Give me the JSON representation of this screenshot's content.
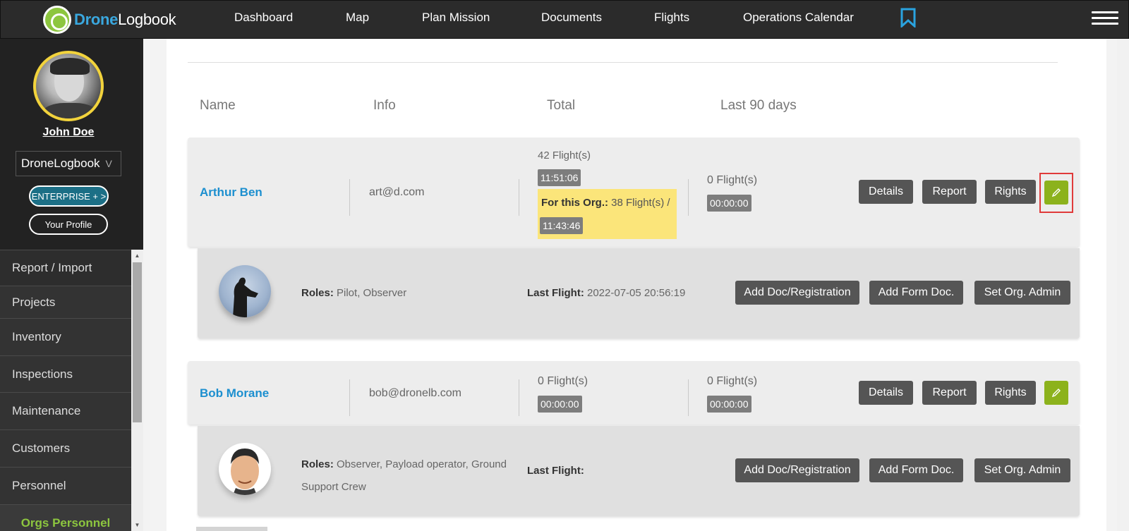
{
  "app": {
    "logo_part1": "Drone",
    "logo_part2": "Logbook"
  },
  "nav": {
    "items": [
      "Dashboard",
      "Map",
      "Plan Mission",
      "Documents",
      "Flights",
      "Operations Calendar"
    ]
  },
  "sidebar": {
    "user_name": "John Doe",
    "org": "DroneLogbook",
    "org_chevron": "V",
    "enterprise_label": "ENTERPRISE + >",
    "profile_label": "Your Profile",
    "menu": [
      "Report / Import",
      "Projects",
      "Inventory",
      "Inspections",
      "Maintenance",
      "Customers",
      "Personnel",
      "Orgs Personnel"
    ]
  },
  "table": {
    "headers": [
      "Name",
      "Info",
      "Total",
      "Last 90 days"
    ]
  },
  "people": [
    {
      "name": "Arthur Ben",
      "email": "art@d.com",
      "total_flights": "42 Flight(s)",
      "total_time": "11:51:06",
      "org_label": "For this Org.:",
      "org_flights": "38 Flight(s) /",
      "org_time": "11:43:46",
      "last90_flights": "0 Flight(s)",
      "last90_time": "00:00:00",
      "roles_label": "Roles:",
      "roles": "Pilot, Observer",
      "last_flight_label": "Last Flight:",
      "last_flight": "2022-07-05 20:56:19"
    },
    {
      "name": "Bob Morane",
      "email": "bob@dronelb.com",
      "total_flights": "0 Flight(s)",
      "total_time": "00:00:00",
      "last90_flights": "0 Flight(s)",
      "last90_time": "00:00:00",
      "roles_label": "Roles:",
      "roles_line1": "Observer, Payload operator, Ground",
      "roles_line2": "Support Crew",
      "last_flight_label": "Last Flight:",
      "last_flight": ""
    }
  ],
  "buttons": {
    "details": "Details",
    "report": "Report",
    "rights": "Rights",
    "add_doc": "Add Doc/Registration",
    "add_form": "Add Form Doc.",
    "set_admin": "Set Org. Admin"
  },
  "icons": {
    "bookmark": "bookmark-icon",
    "menu": "hamburger-menu-icon",
    "edit": "pencil-icon"
  },
  "colors": {
    "topbar": "#2b2b2b",
    "accent_blue": "#1c8fcf",
    "accent_green": "#8cb21c",
    "highlight_yellow": "#fbe57a",
    "button_dark": "#555555"
  }
}
